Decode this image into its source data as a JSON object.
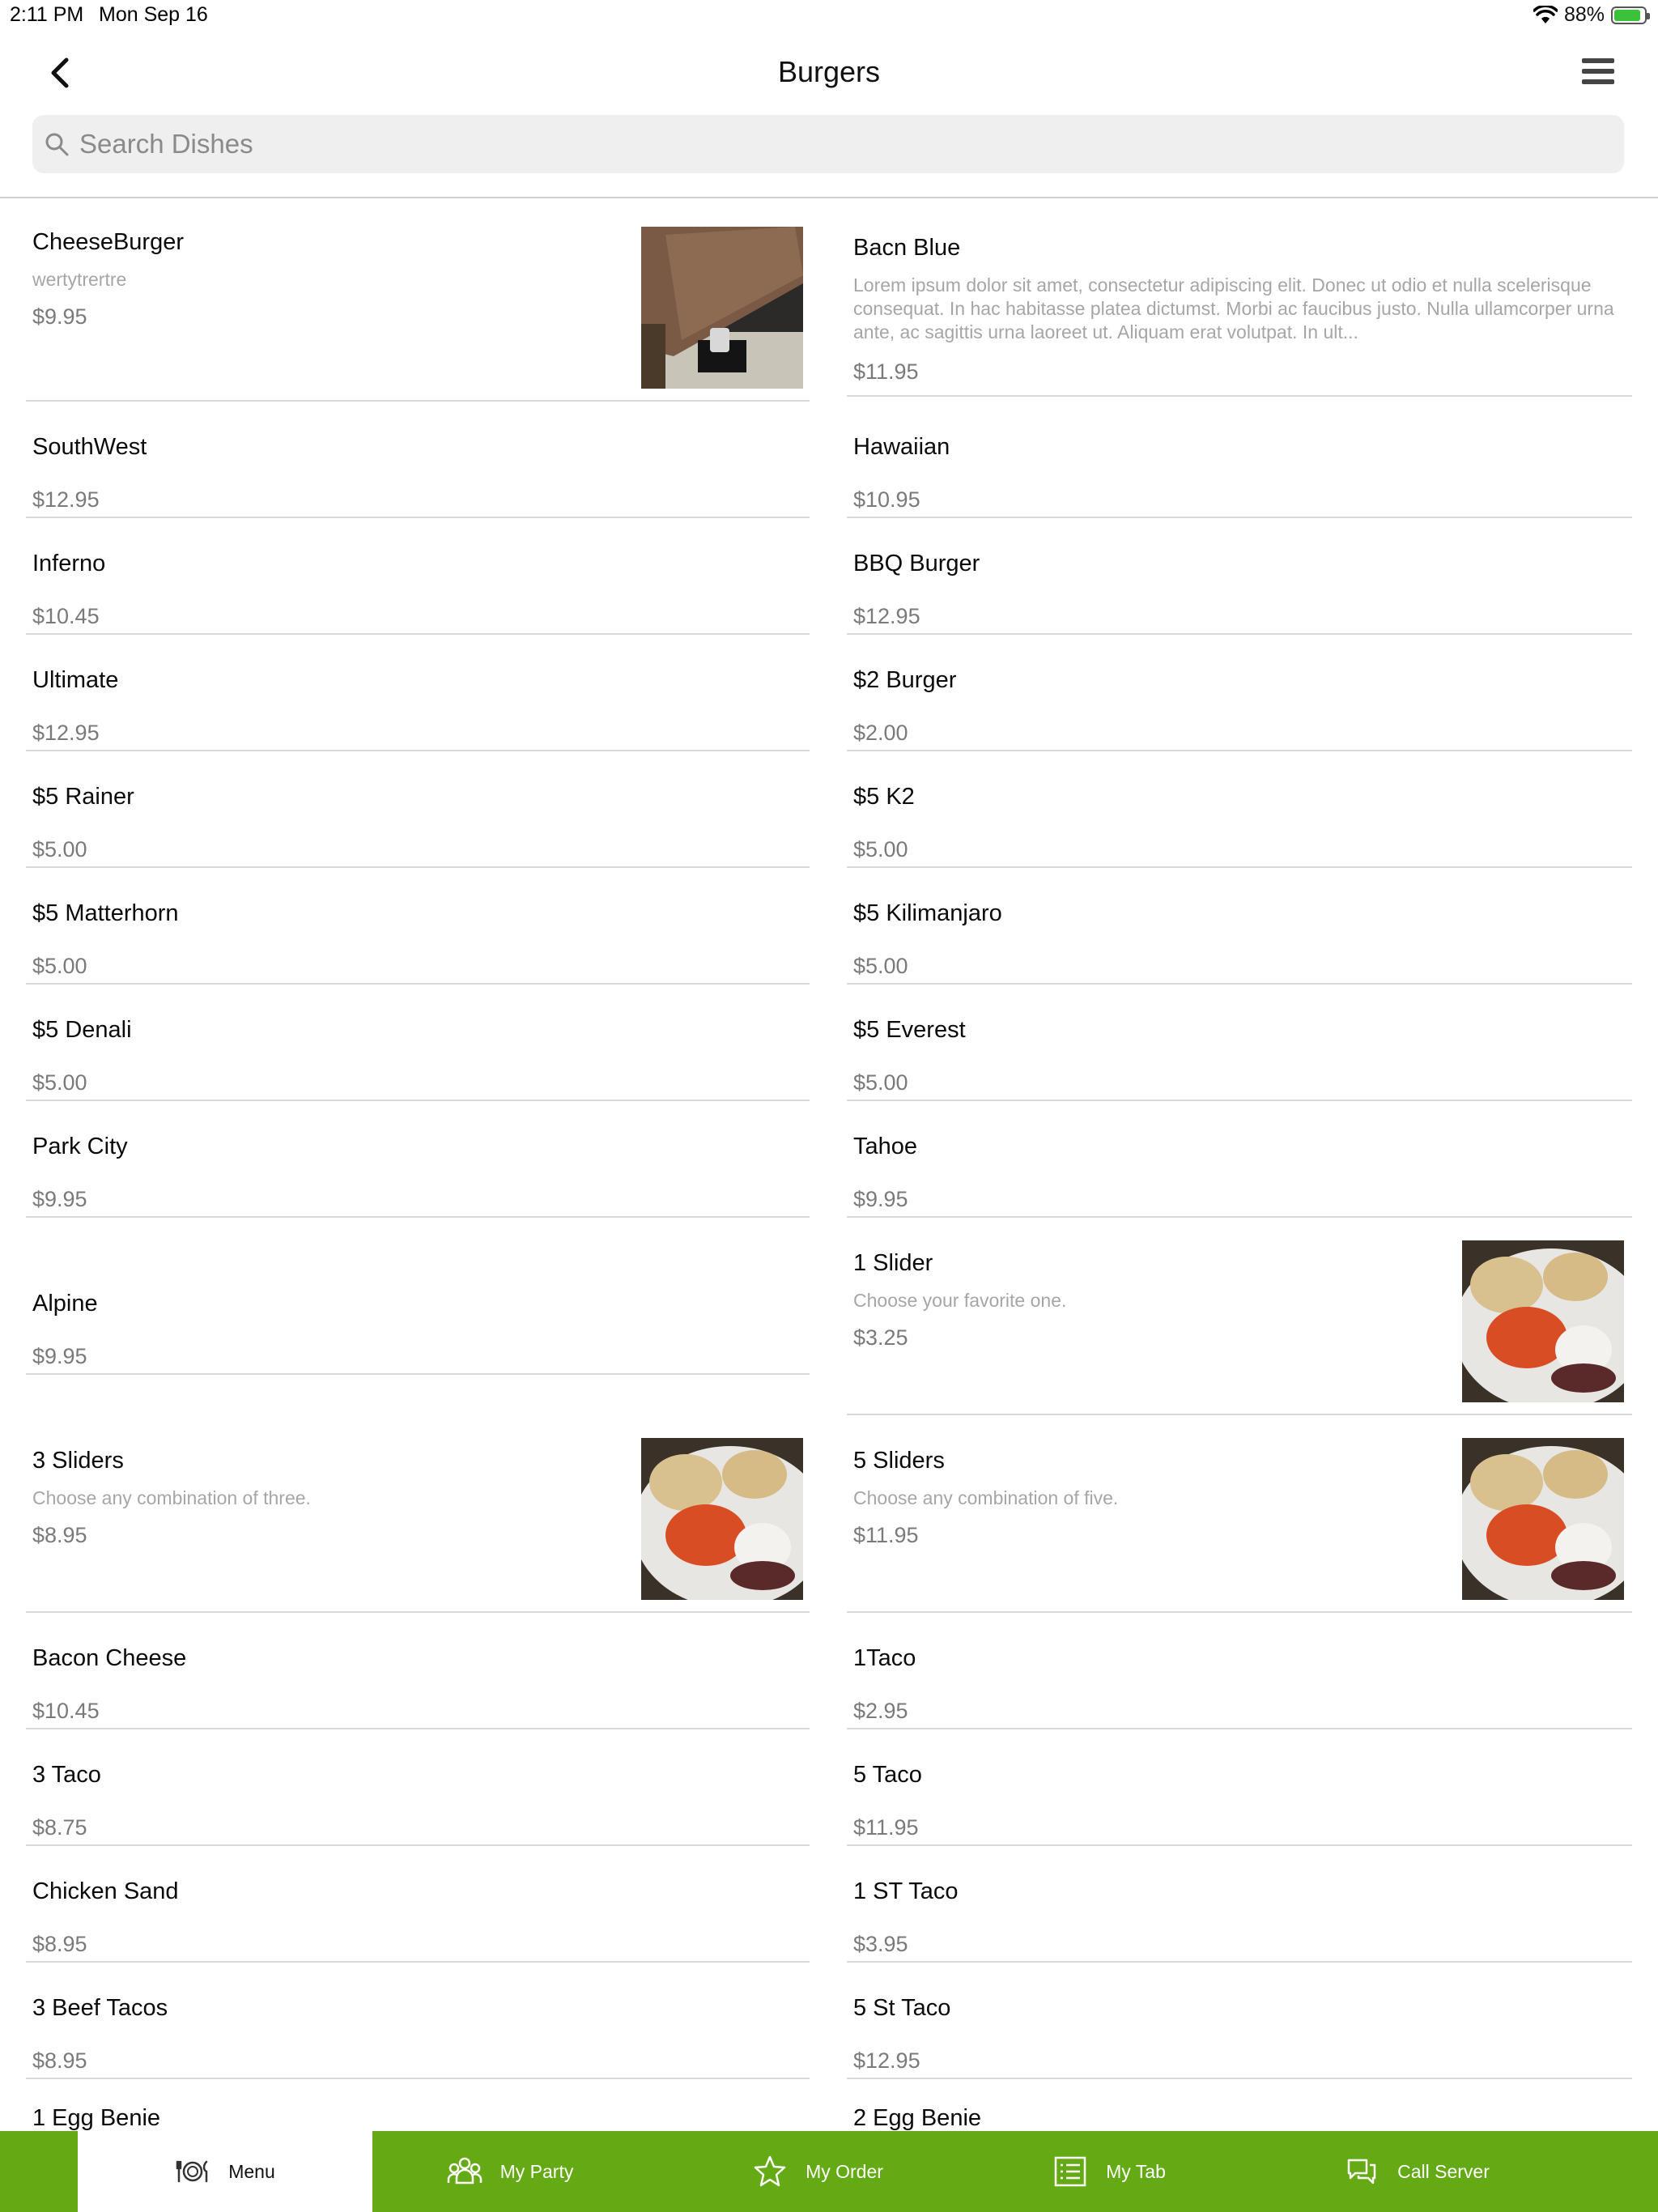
{
  "status_bar": {
    "time": "2:11 PM",
    "date": "Mon Sep 16",
    "battery": "88%"
  },
  "nav": {
    "title": "Burgers"
  },
  "search": {
    "placeholder": "Search Dishes"
  },
  "colors": {
    "accent": "#64aa14",
    "price": "#7a7a7a",
    "description": "#a6a6a6"
  },
  "menu_items": {
    "cheeseburger": {
      "name": "CheeseBurger",
      "description": "wertytrertre",
      "price": "$9.95"
    },
    "bacn_blue": {
      "name": "Bacn Blue",
      "description": "Lorem ipsum dolor sit amet, consectetur adipiscing elit. Donec ut odio et nulla scelerisque consequat. In hac habitasse platea dictumst. Morbi ac faucibus justo. Nulla ullamcorper urna ante, ac sagittis urna laoreet ut. Aliquam erat volutpat. In ult...",
      "price": "$11.95"
    },
    "southwest": {
      "name": "SouthWest",
      "price": "$12.95"
    },
    "hawaiian": {
      "name": "Hawaiian",
      "price": "$10.95"
    },
    "inferno": {
      "name": "Inferno",
      "price": "$10.45"
    },
    "bbq_burger": {
      "name": "BBQ Burger",
      "price": "$12.95"
    },
    "ultimate": {
      "name": "Ultimate",
      "price": "$12.95"
    },
    "two_burger": {
      "name": "$2 Burger",
      "price": "$2.00"
    },
    "rainer": {
      "name": "$5 Rainer",
      "price": "$5.00"
    },
    "k2": {
      "name": "$5 K2",
      "price": "$5.00"
    },
    "matterhorn": {
      "name": "$5 Matterhorn",
      "price": "$5.00"
    },
    "kilimanjaro": {
      "name": "$5 Kilimanjaro",
      "price": "$5.00"
    },
    "denali": {
      "name": "$5 Denali",
      "price": "$5.00"
    },
    "everest": {
      "name": "$5 Everest",
      "price": "$5.00"
    },
    "park_city": {
      "name": "Park City",
      "price": "$9.95"
    },
    "tahoe": {
      "name": "Tahoe",
      "price": "$9.95"
    },
    "alpine": {
      "name": "Alpine",
      "price": "$9.95"
    },
    "one_slider": {
      "name": "1 Slider",
      "description": "Choose your favorite one.",
      "price": "$3.25"
    },
    "three_sliders": {
      "name": "3 Sliders",
      "description": "Choose any combination of three.",
      "price": "$8.95"
    },
    "five_sliders": {
      "name": "5 Sliders",
      "description": "Choose any combination of five.",
      "price": "$11.95"
    },
    "bacon_cheese": {
      "name": "Bacon Cheese",
      "price": "$10.45"
    },
    "one_taco": {
      "name": "1Taco",
      "price": "$2.95"
    },
    "three_taco": {
      "name": "3 Taco",
      "price": "$8.75"
    },
    "five_taco": {
      "name": "5 Taco",
      "price": "$11.95"
    },
    "chicken_sand": {
      "name": "Chicken Sand",
      "price": "$8.95"
    },
    "one_st_taco": {
      "name": "1 ST Taco",
      "price": "$3.95"
    },
    "three_beef_tacos": {
      "name": "3 Beef Tacos",
      "price": "$8.95"
    },
    "five_st_taco": {
      "name": "5 St Taco",
      "price": "$12.95"
    },
    "one_egg_benie": {
      "name": "1 Egg Benie"
    },
    "two_egg_benie": {
      "name": "2 Egg Benie"
    }
  },
  "tabs": [
    {
      "label": "Menu",
      "icon": "plate-cutlery-icon",
      "active": true
    },
    {
      "label": "My Party",
      "icon": "people-icon"
    },
    {
      "label": "My Order",
      "icon": "star-icon"
    },
    {
      "label": "My Tab",
      "icon": "list-icon"
    },
    {
      "label": "Call Server",
      "icon": "chat-bubbles-icon"
    }
  ]
}
